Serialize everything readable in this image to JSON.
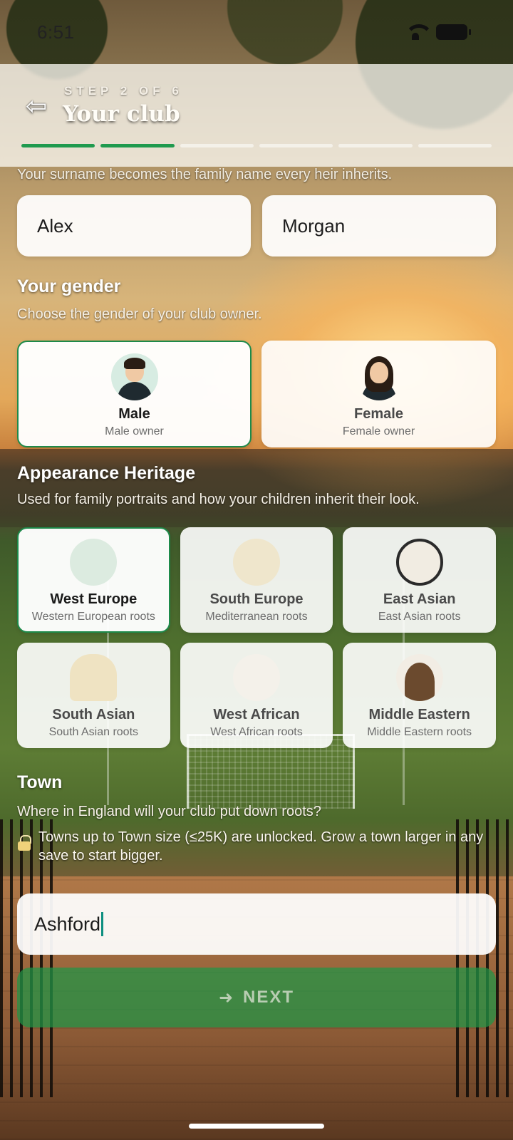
{
  "status_bar": {
    "time": "6:51"
  },
  "header": {
    "step_label": "STEP 2 OF 6",
    "title": "Your club",
    "progress_total": 6,
    "progress_done": 2
  },
  "name_section": {
    "hint": "Your surname becomes the family name every heir inherits.",
    "first_name_value": "Alex",
    "surname_value": "Morgan"
  },
  "gender_section": {
    "title": "Your gender",
    "subtitle": "Choose the gender of your club owner.",
    "options": [
      {
        "title": "Male",
        "sub": "Male owner",
        "selected": true
      },
      {
        "title": "Female",
        "sub": "Female owner",
        "selected": false
      }
    ]
  },
  "heritage_section": {
    "title": "Appearance Heritage",
    "subtitle": "Used for family portraits and how your children inherit their look.",
    "options": [
      {
        "title": "West Europe",
        "sub": "Western European roots",
        "selected": true
      },
      {
        "title": "South Europe",
        "sub": "Mediterranean roots",
        "selected": false
      },
      {
        "title": "East Asian",
        "sub": "East Asian roots",
        "selected": false
      },
      {
        "title": "South Asian",
        "sub": "South Asian roots",
        "selected": false
      },
      {
        "title": "West African",
        "sub": "West African roots",
        "selected": false
      },
      {
        "title": "Middle Eastern",
        "sub": "Middle Eastern roots",
        "selected": false
      }
    ]
  },
  "town_section": {
    "title": "Town",
    "subtitle": "Where in England will your club put down roots?",
    "lock_note": "Towns up to Town size (≤25K) are unlocked. Grow a town larger in any save to start bigger.",
    "town_value": "Ashford"
  },
  "next_button": {
    "label": "NEXT"
  },
  "colors": {
    "accent": "#1f9a4e",
    "selected_border": "#1d8a4a",
    "caret": "#0e8f80"
  }
}
